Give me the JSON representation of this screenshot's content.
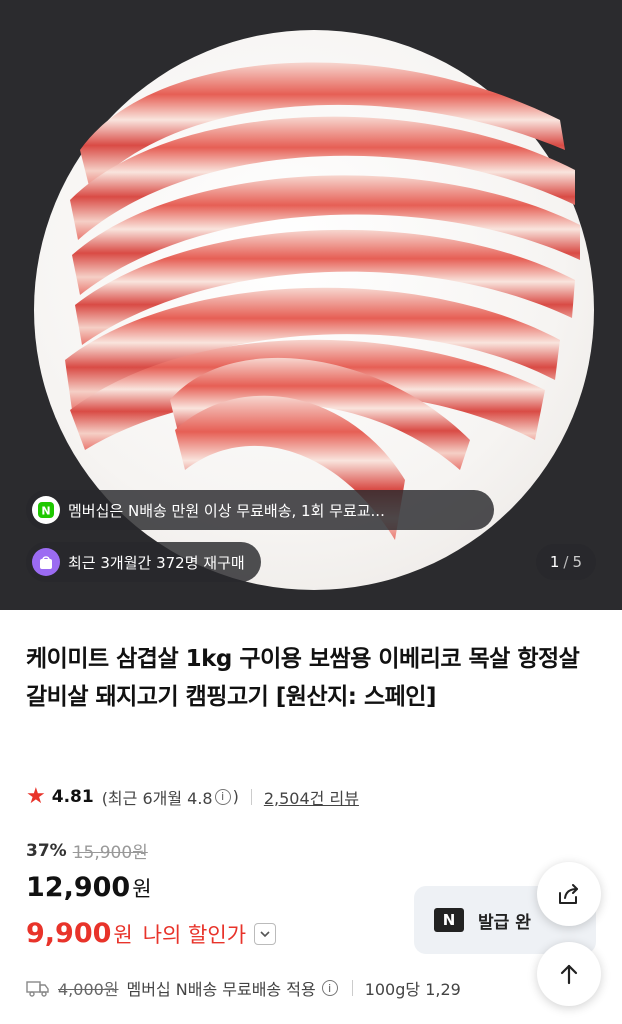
{
  "gallery": {
    "member_banner": "멤버십은 N배송 만원 이상 무료배송, 1회 무료교...",
    "repurchase_banner": "최근 3개월간 372명 재구매",
    "current": "1",
    "separator": "/",
    "total": "5"
  },
  "product": {
    "title": "케이미트 삼겹살 1kg 구이용 보쌈용 이베리코 목살 항정살 갈비살 돼지고기 캠핑고기 [원산지: 스페인]",
    "rating": "4.81",
    "recent_rating_label": "(최근 6개월 4.8",
    "recent_rating_close": ")",
    "review_count": "2,504건 리뷰",
    "discount_rate": "37%",
    "original_price": "15,900원",
    "sale_price": "12,900",
    "sale_price_unit": "원",
    "my_price": "9,900",
    "my_price_unit": "원",
    "my_price_label": "나의 할인가"
  },
  "coupon": {
    "logo": "N",
    "label": "발급 완"
  },
  "shipping": {
    "original_fee": "4,000원",
    "text": "멤버십 N배송 무료배송 적용",
    "unit_price": "100g당 1,29"
  },
  "icons": {
    "info": "i",
    "share": "share-icon",
    "top": "arrow-up-icon",
    "star": "★"
  },
  "colors": {
    "accent_red": "#e8332a",
    "repurchase_purple": "#9b6bf2",
    "member_green": "#1ec800"
  }
}
